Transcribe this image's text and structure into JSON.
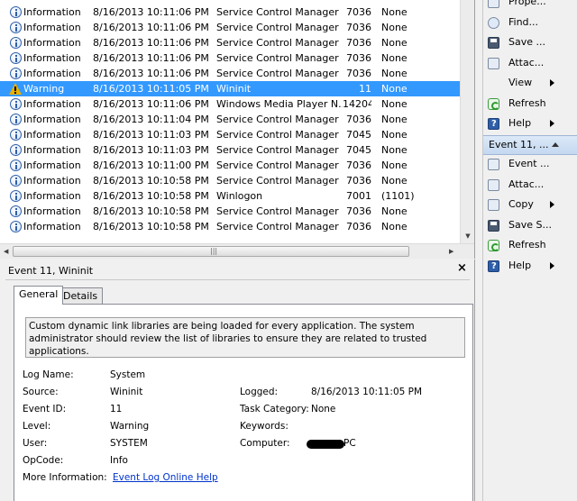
{
  "events": {
    "rows": [
      {
        "level": "Information",
        "icon": "information-icon",
        "date": "8/16/2013 10:11:06 PM",
        "source": "Service Control Manager",
        "event_id": "7036",
        "task": "None",
        "selected": false
      },
      {
        "level": "Information",
        "icon": "information-icon",
        "date": "8/16/2013 10:11:06 PM",
        "source": "Service Control Manager",
        "event_id": "7036",
        "task": "None",
        "selected": false
      },
      {
        "level": "Information",
        "icon": "information-icon",
        "date": "8/16/2013 10:11:06 PM",
        "source": "Service Control Manager",
        "event_id": "7036",
        "task": "None",
        "selected": false
      },
      {
        "level": "Information",
        "icon": "information-icon",
        "date": "8/16/2013 10:11:06 PM",
        "source": "Service Control Manager",
        "event_id": "7036",
        "task": "None",
        "selected": false
      },
      {
        "level": "Information",
        "icon": "information-icon",
        "date": "8/16/2013 10:11:06 PM",
        "source": "Service Control Manager",
        "event_id": "7036",
        "task": "None",
        "selected": false
      },
      {
        "level": "Warning",
        "icon": "warning-icon",
        "date": "8/16/2013 10:11:05 PM",
        "source": "Wininit",
        "event_id": "11",
        "task": "None",
        "selected": true
      },
      {
        "level": "Information",
        "icon": "information-icon",
        "date": "8/16/2013 10:11:06 PM",
        "source": "Windows Media Player N...",
        "event_id": "14204",
        "task": "None",
        "selected": false
      },
      {
        "level": "Information",
        "icon": "information-icon",
        "date": "8/16/2013 10:11:04 PM",
        "source": "Service Control Manager",
        "event_id": "7036",
        "task": "None",
        "selected": false
      },
      {
        "level": "Information",
        "icon": "information-icon",
        "date": "8/16/2013 10:11:03 PM",
        "source": "Service Control Manager",
        "event_id": "7045",
        "task": "None",
        "selected": false
      },
      {
        "level": "Information",
        "icon": "information-icon",
        "date": "8/16/2013 10:11:03 PM",
        "source": "Service Control Manager",
        "event_id": "7045",
        "task": "None",
        "selected": false
      },
      {
        "level": "Information",
        "icon": "information-icon",
        "date": "8/16/2013 10:11:00 PM",
        "source": "Service Control Manager",
        "event_id": "7036",
        "task": "None",
        "selected": false
      },
      {
        "level": "Information",
        "icon": "information-icon",
        "date": "8/16/2013 10:10:58 PM",
        "source": "Service Control Manager",
        "event_id": "7036",
        "task": "None",
        "selected": false
      },
      {
        "level": "Information",
        "icon": "information-icon",
        "date": "8/16/2013 10:10:58 PM",
        "source": "Winlogon",
        "event_id": "7001",
        "task": "(1101)",
        "selected": false
      },
      {
        "level": "Information",
        "icon": "information-icon",
        "date": "8/16/2013 10:10:58 PM",
        "source": "Service Control Manager",
        "event_id": "7036",
        "task": "None",
        "selected": false
      },
      {
        "level": "Information",
        "icon": "information-icon",
        "date": "8/16/2013 10:10:58 PM",
        "source": "Service Control Manager",
        "event_id": "7036",
        "task": "None",
        "selected": false
      }
    ],
    "selected_color": "#3399ff"
  },
  "detail": {
    "title": "Event 11, Wininit",
    "close_label": "×",
    "tabs": {
      "general": "General",
      "details": "Details"
    },
    "description": "Custom dynamic link libraries are being loaded for every application. The system administrator should review the list of libraries to ensure they are related to trusted applications.",
    "fields": {
      "log_name_label": "Log Name:",
      "log_name": "System",
      "source_label": "Source:",
      "source": "Wininit",
      "logged_label": "Logged:",
      "logged": "8/16/2013 10:11:05 PM",
      "event_id_label": "Event ID:",
      "event_id": "11",
      "task_category_label": "Task Category:",
      "task_category": "None",
      "level_label": "Level:",
      "level": "Warning",
      "keywords_label": "Keywords:",
      "keywords": "",
      "user_label": "User:",
      "user": "SYSTEM",
      "computer_label": "Computer:",
      "computer": "PC",
      "opcode_label": "OpCode:",
      "opcode": "Info",
      "more_info_label": "More Information:",
      "more_info_link": "Event Log Online Help"
    }
  },
  "actions": {
    "top": [
      {
        "label": "Prope...",
        "icon": "properties-icon",
        "arrow": false
      },
      {
        "label": "Find...",
        "icon": "find-icon",
        "arrow": false
      },
      {
        "label": "Save ...",
        "icon": "save-icon",
        "arrow": false
      },
      {
        "label": "Attac...",
        "icon": "attach-task-icon",
        "arrow": false
      },
      {
        "label": "View",
        "icon": "",
        "arrow": true
      },
      {
        "label": "Refresh",
        "icon": "refresh-icon",
        "arrow": false
      },
      {
        "label": "Help",
        "icon": "help-icon",
        "arrow": true
      }
    ],
    "group_label": "Event 11, ...",
    "group": [
      {
        "label": "Event ...",
        "icon": "event-properties-icon",
        "arrow": false
      },
      {
        "label": "Attac...",
        "icon": "attach-task-icon",
        "arrow": false
      },
      {
        "label": "Copy",
        "icon": "copy-icon",
        "arrow": true
      },
      {
        "label": "Save S...",
        "icon": "save-icon",
        "arrow": false
      },
      {
        "label": "Refresh",
        "icon": "refresh-icon",
        "arrow": false
      },
      {
        "label": "Help",
        "icon": "help-icon",
        "arrow": true
      }
    ]
  }
}
